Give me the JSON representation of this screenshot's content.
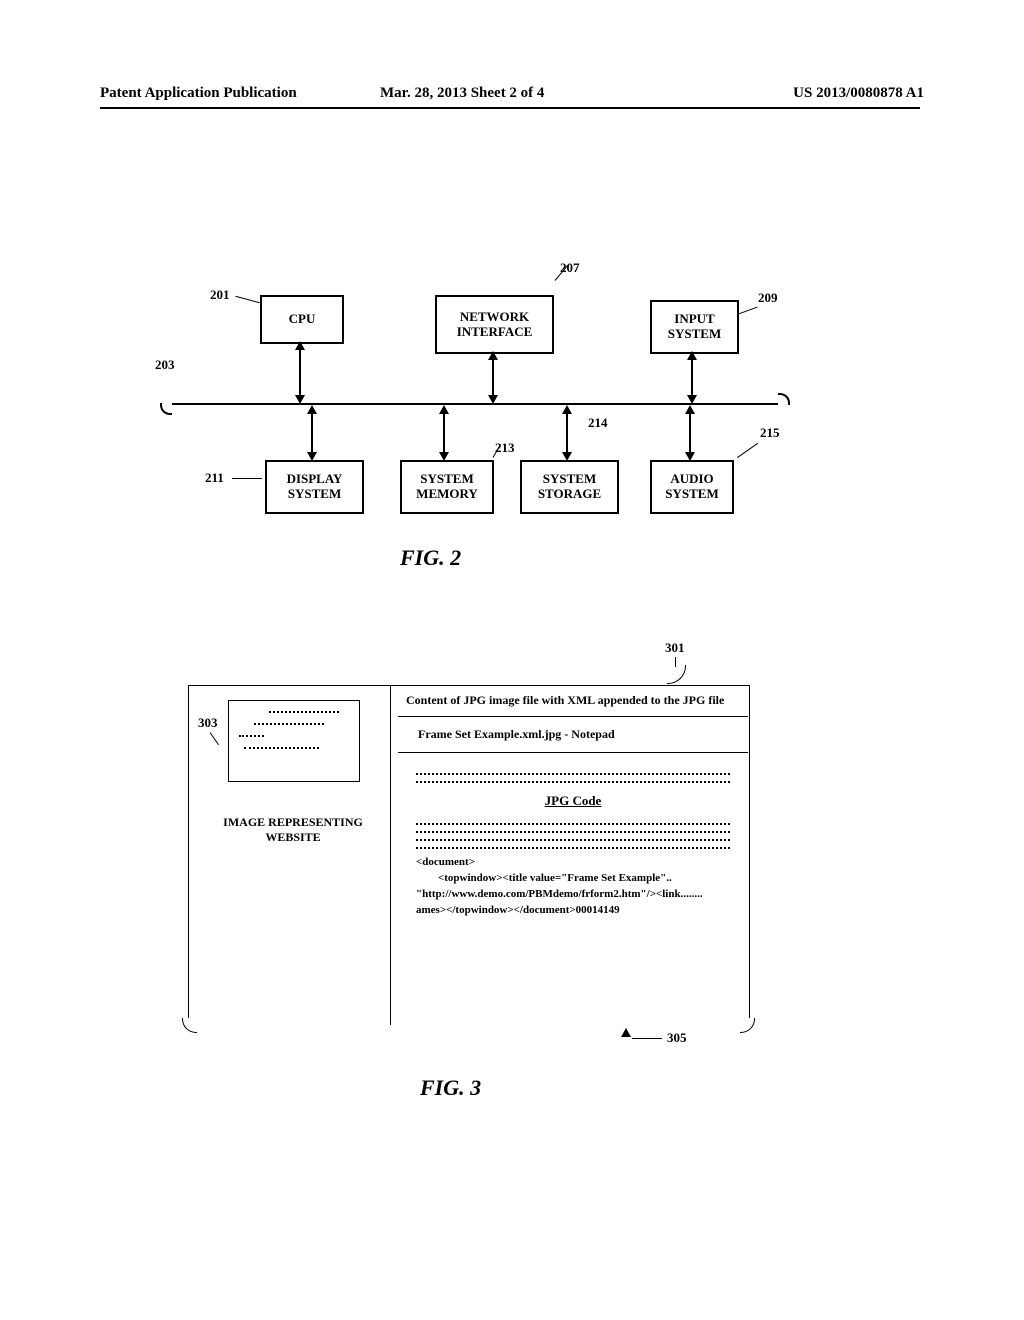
{
  "header": {
    "left": "Patent Application Publication",
    "center": "Mar. 28, 2013  Sheet 2 of 4",
    "right": "US 2013/0080878 A1"
  },
  "fig2": {
    "boxes": {
      "cpu": "CPU",
      "net": "NETWORK INTERFACE",
      "input": "INPUT SYSTEM",
      "disp": "DISPLAY SYSTEM",
      "mem": "SYSTEM MEMORY",
      "stor": "SYSTEM STORAGE",
      "aud": "AUDIO SYSTEM"
    },
    "refs": {
      "r201": "201",
      "r203": "203",
      "r207": "207",
      "r209": "209",
      "r211": "211",
      "r213": "213",
      "r214": "214",
      "r215": "215"
    },
    "caption": "FIG. 2"
  },
  "fig3": {
    "left_label": "IMAGE REPRESENTING WEBSITE",
    "heading": "Content of JPG image file with XML appended to the JPG file",
    "subheading": "Frame Set Example.xml.jpg  - Notepad",
    "jpg_code_label": "JPG Code",
    "xml_text": "<document>\n        <topwindow><title value=\"Frame Set Example\"..\n\"http://www.demo.com/PBMdemo/frform2.htm\"/><link........\names></topwindow></document>00014149",
    "refs": {
      "r301": "301",
      "r303": "303",
      "r305": "305"
    },
    "caption": "FIG. 3"
  }
}
